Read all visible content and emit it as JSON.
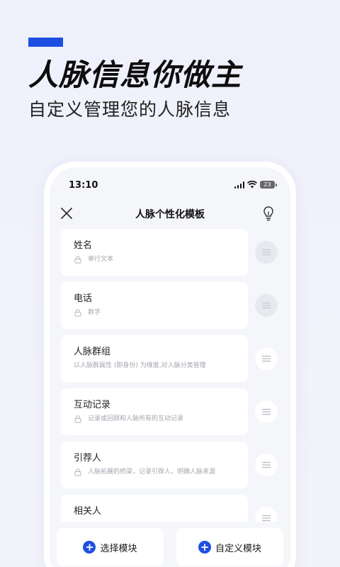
{
  "promo": {
    "headline": "人脉信息你做主",
    "subheadline": "自定义管理您的人脉信息",
    "accent_color": "#1f4fe0"
  },
  "status_bar": {
    "time": "13:10",
    "battery": "23"
  },
  "nav": {
    "title": "人脉个性化模板",
    "left_icon": "close-icon",
    "right_icon": "lightbulb-icon"
  },
  "fields": [
    {
      "title": "姓名",
      "subtitle": "单行文本",
      "locked": true
    },
    {
      "title": "电话",
      "subtitle": "数字",
      "locked": true
    },
    {
      "title": "人脉群组",
      "subtitle": "以人脉群属性 (即身份) 为维度,对人脉分类管理",
      "locked": false
    },
    {
      "title": "互动记录",
      "subtitle": "记录或回顾和人脉所有的互动记录",
      "locked": true
    },
    {
      "title": "引荐人",
      "subtitle": "人脉拓展的桥梁，记录引荐人，明确人脉来源",
      "locked": true
    },
    {
      "title": "相关人",
      "subtitle": "",
      "locked": false
    }
  ],
  "actions": {
    "select_module": "选择模块",
    "custom_module": "自定义模块"
  }
}
